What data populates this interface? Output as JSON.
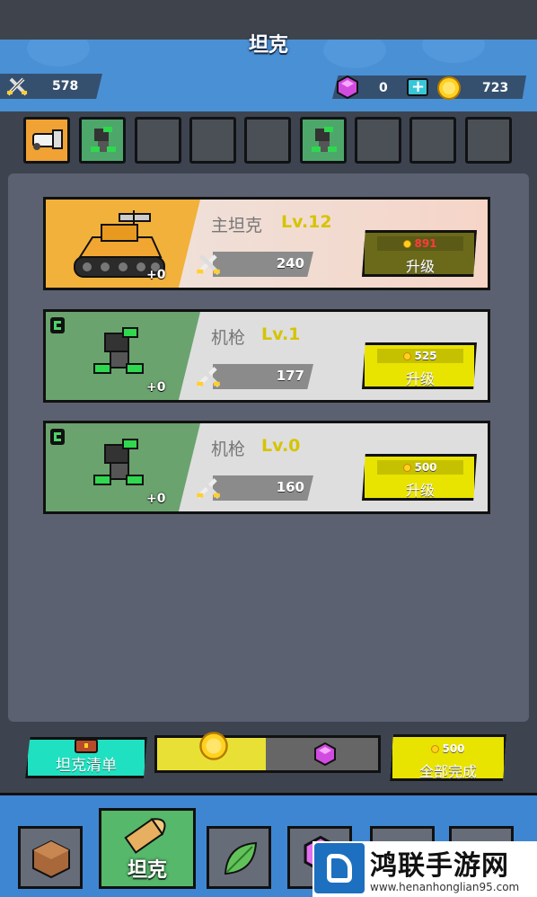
{
  "header": {
    "title": "坦克"
  },
  "resources": {
    "power": "578",
    "gems": "0",
    "gold": "723"
  },
  "slots": [
    {
      "kind": "cannon",
      "style": "orange"
    },
    {
      "kind": "gun",
      "style": "green"
    },
    {
      "kind": "empty",
      "style": "empty"
    },
    {
      "kind": "empty",
      "style": "empty"
    },
    {
      "kind": "empty",
      "style": "empty"
    },
    {
      "kind": "gun",
      "style": "green"
    },
    {
      "kind": "empty",
      "style": "empty"
    },
    {
      "kind": "empty",
      "style": "empty"
    },
    {
      "kind": "empty",
      "style": "empty"
    }
  ],
  "cards": [
    {
      "name": "主坦克",
      "level": "Lv.12",
      "plus": "+0",
      "power": "240",
      "cost": "891",
      "action": "升级",
      "affordable": false
    },
    {
      "name": "机枪",
      "level": "Lv.1",
      "plus": "+0",
      "power": "177",
      "cost": "525",
      "action": "升级",
      "affordable": true
    },
    {
      "name": "机枪",
      "level": "Lv.0",
      "plus": "+0",
      "power": "160",
      "cost": "500",
      "action": "升级",
      "affordable": true
    }
  ],
  "footer": {
    "list_label": "坦克清单",
    "progress": 0.49,
    "complete_cost": "500",
    "complete_label": "全部完成"
  },
  "nav": {
    "active_label": "坦克"
  },
  "watermark": {
    "title": "鸿联手游网",
    "url": "www.henanhonglian95.com"
  },
  "colors": {
    "accent_yellow": "#e9e300",
    "header_blue": "#4a90d4",
    "gold": "#ffd21f",
    "gem": "#d24be0"
  }
}
